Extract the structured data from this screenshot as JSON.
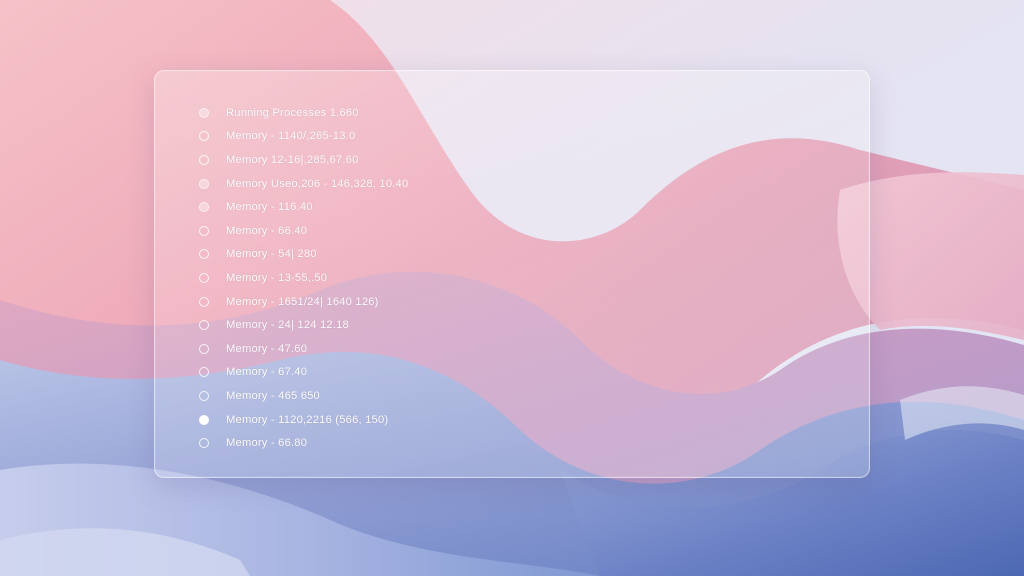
{
  "process_list": {
    "items": [
      {
        "label": "Running Processes 1.660",
        "state": "filled"
      },
      {
        "label": "Memory - 1140/,265-13.0",
        "state": "empty"
      },
      {
        "label": "Memory 12-16|,285,67.60",
        "state": "empty"
      },
      {
        "label": "Memory Useo,206 - 146,328, 10.40",
        "state": "filled"
      },
      {
        "label": "Memory - 116.40",
        "state": "filled"
      },
      {
        "label": "Memory - 66.40",
        "state": "empty"
      },
      {
        "label": "Memory - 54| 280",
        "state": "empty"
      },
      {
        "label": "Memory - 13-55,.50",
        "state": "empty"
      },
      {
        "label": "Memory - 1651/24| 1640 126)",
        "state": "empty"
      },
      {
        "label": "Memory - 24| 124 12.18",
        "state": "empty"
      },
      {
        "label": "Memory - 47.60",
        "state": "empty"
      },
      {
        "label": "Memory - 67.40",
        "state": "empty"
      },
      {
        "label": "Memory - 465 650",
        "state": "empty"
      },
      {
        "label": "Memory - 1120,2216 (566, 150)",
        "state": "selected"
      },
      {
        "label": "Memory - 66.80",
        "state": "empty"
      }
    ]
  },
  "colors": {
    "wallpaper_pink": "#eeb0bf",
    "wallpaper_lavender": "#b7a4cf",
    "wallpaper_blue": "#6f86c4",
    "wallpaper_sky": "#e4eaf6",
    "text": "#ffffff"
  }
}
